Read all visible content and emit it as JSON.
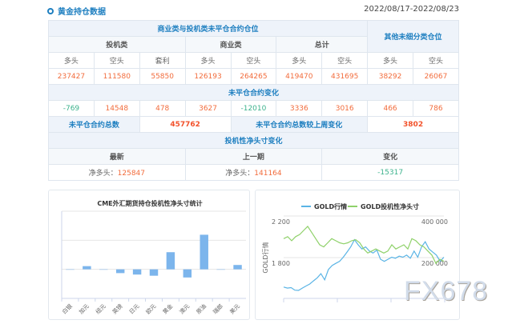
{
  "header": {
    "title": "黄金持仓数据",
    "date_range": "2022/08/17-2022/08/23"
  },
  "table": {
    "group_title": "商业类与投机类未平仓合约仓位",
    "other_title": "其他未细分类仓位",
    "groups": [
      "投机类",
      "商业类",
      "总计"
    ],
    "columns": [
      "多头",
      "空头",
      "套利",
      "多头",
      "空头",
      "多头",
      "空头",
      "多头",
      "空头"
    ],
    "positions": [
      "237427",
      "111580",
      "55850",
      "126193",
      "264265",
      "419470",
      "431695",
      "38292",
      "26067"
    ],
    "change_title": "未平仓合约变化",
    "changes": [
      "-769",
      "14548",
      "478",
      "3627",
      "-12010",
      "3336",
      "3016",
      "466",
      "786"
    ],
    "total_label": "未平仓合约总数",
    "total_value": "457762",
    "total_change_label": "未平仓合约总数较上周变化",
    "total_change_value": "3802",
    "net_title": "投机性净头寸变化",
    "net_headers": [
      "最新",
      "上一期",
      "变化"
    ],
    "net_prefix": "净多头：",
    "net_latest": "125847",
    "net_prev": "141164",
    "net_change": "-15317"
  },
  "chart_data": [
    {
      "type": "bar",
      "title": "CME外汇期货持仓投机性净头寸统计",
      "categories": [
        "白银",
        "加元",
        "纽元",
        "英镑",
        "日元",
        "欧元",
        "黄金",
        "澳元",
        "原油",
        "瑞郎",
        "美元"
      ],
      "values": [
        0,
        11000,
        0,
        -13000,
        -18000,
        -22000,
        59000,
        -28000,
        119000,
        0,
        15000
      ],
      "ylim": [
        -100000,
        200000
      ],
      "color": "#7cb5ec"
    },
    {
      "type": "line",
      "legend": [
        "GOLD行情",
        "GOLD投机性净头寸"
      ],
      "ylabel": "GOLD行情",
      "left_ticks": [
        "2 200",
        "1 800"
      ],
      "right_ticks": [
        "400 000",
        "200 000"
      ],
      "left_range": [
        1400,
        2200
      ],
      "right_range": [
        0,
        400000
      ],
      "series": [
        {
          "name": "GOLD行情",
          "axis": "left",
          "color": "#5ab4e5",
          "values": [
            1510,
            1500,
            1505,
            1480,
            1478,
            1500,
            1520,
            1540,
            1570,
            1600,
            1640,
            1580,
            1680,
            1720,
            1740,
            1760,
            1800,
            1850,
            1900,
            1970,
            1920,
            1880,
            1900,
            1860,
            1840,
            1870,
            1780,
            1760,
            1780,
            1800,
            1790,
            1810,
            1800,
            1820,
            1790,
            1860,
            1800,
            1900,
            1950,
            1880,
            1850,
            1820,
            1760,
            1800
          ]
        },
        {
          "name": "GOLD投机性净头寸",
          "axis": "right",
          "color": "#8fd16a",
          "values": [
            290000,
            300000,
            280000,
            300000,
            310000,
            330000,
            350000,
            320000,
            290000,
            260000,
            250000,
            270000,
            290000,
            280000,
            270000,
            265000,
            270000,
            280000,
            285000,
            270000,
            240000,
            220000,
            230000,
            240000,
            230000,
            220000,
            230000,
            260000,
            240000,
            250000,
            260000,
            240000,
            290000,
            280000,
            260000,
            250000,
            230000,
            210000,
            170000,
            190000,
            180000
          ]
        }
      ]
    }
  ],
  "watermark": "FX678"
}
